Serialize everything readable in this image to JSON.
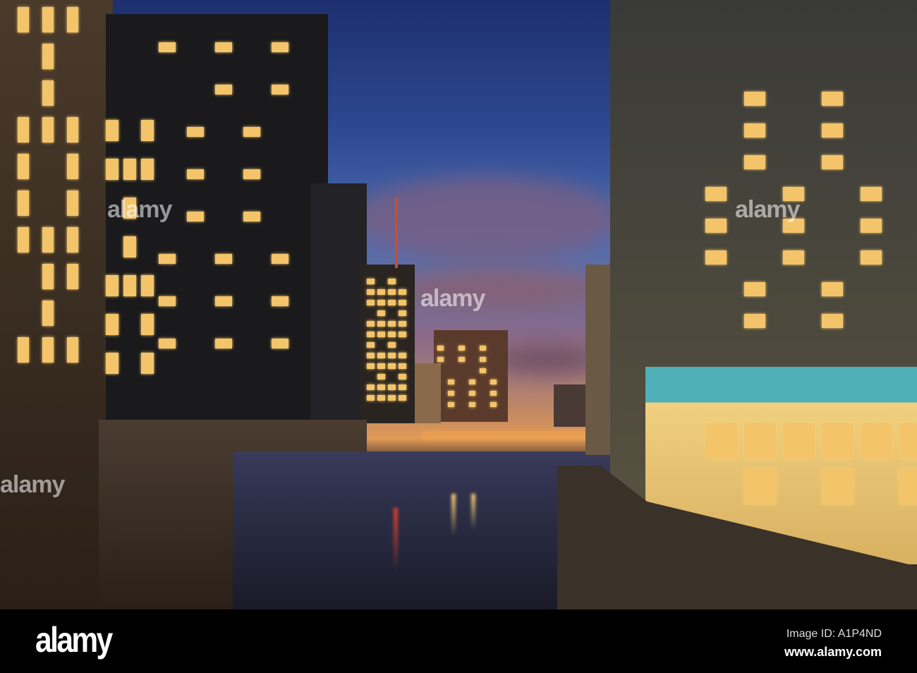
{
  "watermark": {
    "logo": "alamy",
    "tile": "alamy",
    "image_id": "Image ID: A1P4ND",
    "site": "www.alamy.com"
  },
  "colors": {
    "sky_top": "#1d2f6e",
    "horizon": "#e09a55",
    "window_light": "#f4c46a"
  }
}
